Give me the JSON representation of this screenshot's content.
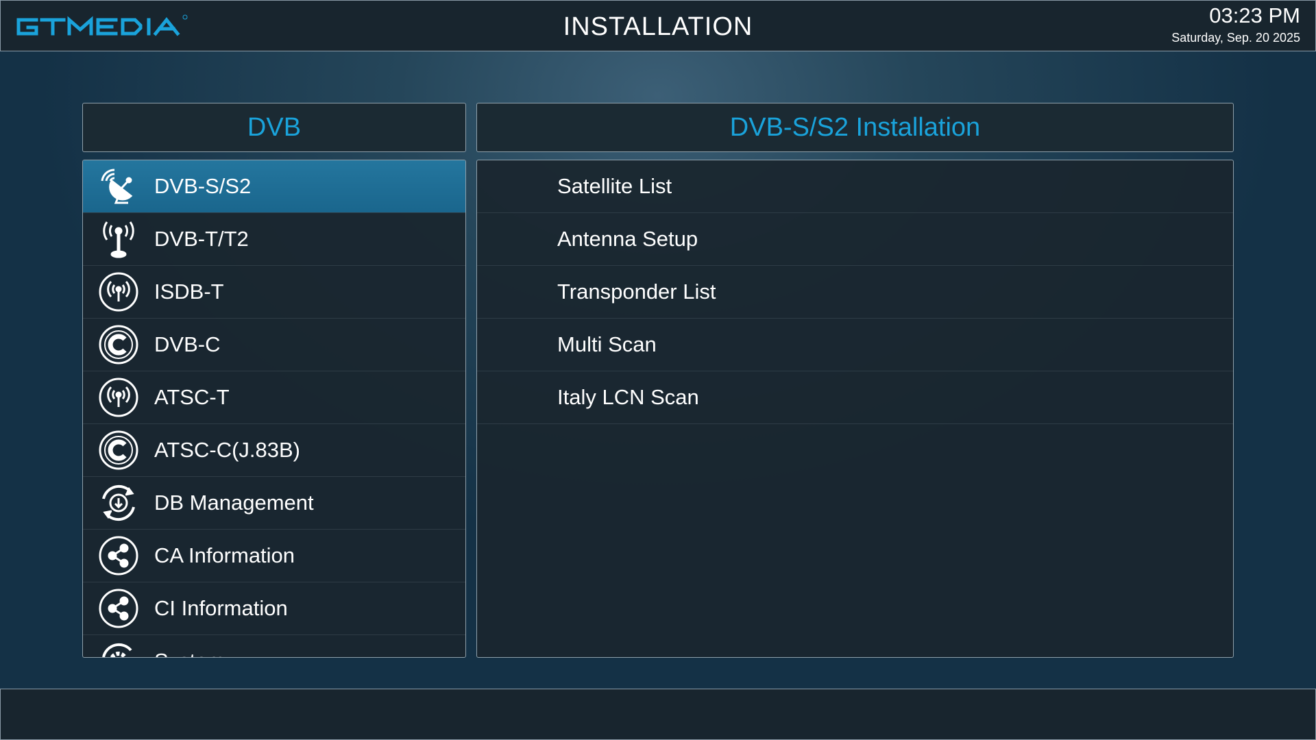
{
  "header": {
    "brand": "GTMEDIA",
    "title": "INSTALLATION",
    "time": "03:23 PM",
    "date": "Saturday, Sep. 20 2025"
  },
  "left_panel": {
    "title": "DVB",
    "items": [
      {
        "label": "DVB-S/S2",
        "icon": "satellite-dish-icon",
        "selected": true
      },
      {
        "label": "DVB-T/T2",
        "icon": "antenna-icon",
        "selected": false
      },
      {
        "label": "ISDB-T",
        "icon": "broadcast-icon",
        "selected": false
      },
      {
        "label": "DVB-C",
        "icon": "cable-icon",
        "selected": false
      },
      {
        "label": "ATSC-T",
        "icon": "broadcast-icon",
        "selected": false
      },
      {
        "label": "ATSC-C(J.83B)",
        "icon": "cable-icon",
        "selected": false
      },
      {
        "label": "DB Management",
        "icon": "database-sync-icon",
        "selected": false
      },
      {
        "label": "CA Information",
        "icon": "share-icon",
        "selected": false
      },
      {
        "label": "CI Information",
        "icon": "share-icon",
        "selected": false
      },
      {
        "label": "System",
        "icon": "gear-icon",
        "selected": false
      }
    ]
  },
  "right_panel": {
    "title": "DVB-S/S2 Installation",
    "items": [
      {
        "label": "Satellite List"
      },
      {
        "label": "Antenna Setup"
      },
      {
        "label": "Transponder List"
      },
      {
        "label": "Multi Scan"
      },
      {
        "label": "Italy LCN Scan"
      }
    ]
  },
  "colors": {
    "accent": "#1aa3db",
    "selected_row": "#1f6f97",
    "bar_background": "#18252e"
  }
}
